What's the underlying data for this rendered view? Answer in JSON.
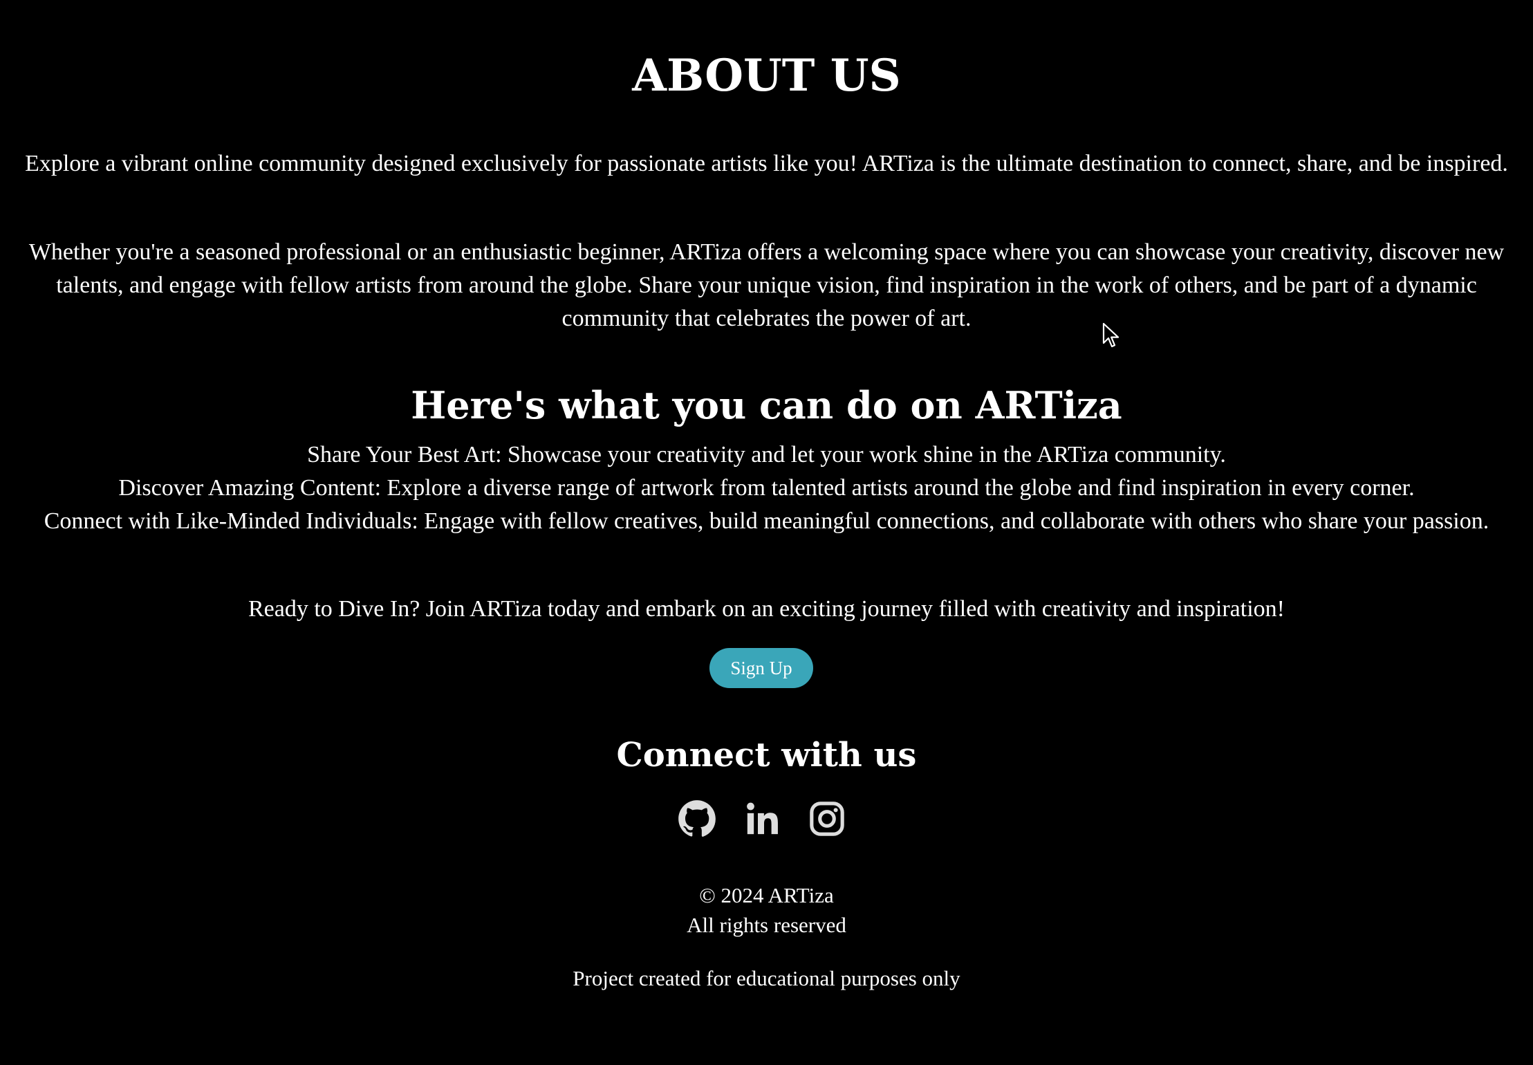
{
  "about": {
    "title": "ABOUT US",
    "intro": "Explore a vibrant online community designed exclusively for passionate artists like you! ARTiza is the ultimate destination to connect, share, and be inspired.",
    "description": "Whether you're a seasoned professional or an enthusiastic beginner, ARTiza offers a welcoming space where you can showcase your creativity, discover new talents, and engage with fellow artists from around the globe. Share your unique vision, find inspiration in the work of others, and be part of a dynamic community that celebrates the power of art."
  },
  "features": {
    "title": "Here's what you can do on ARTiza",
    "items": [
      "Share Your Best Art: Showcase your creativity and let your work shine in the ARTiza community.",
      "Discover Amazing Content: Explore a diverse range of artwork from talented artists around the globe and find inspiration in every corner.",
      "Connect with Like-Minded Individuals: Engage with fellow creatives, build meaningful connections, and collaborate with others who share your passion."
    ]
  },
  "cta": {
    "text": "Ready to Dive In? Join ARTiza today and embark on an exciting journey filled with creativity and inspiration!",
    "signup_label": "Sign Up"
  },
  "connect": {
    "title": "Connect with us",
    "icons": [
      "github-icon",
      "linkedin-icon",
      "instagram-icon"
    ]
  },
  "footer": {
    "copyright": "© 2024 ARTiza",
    "rights": "All rights reserved",
    "note": "Project created for educational purposes only"
  },
  "colors": {
    "background": "#000000",
    "text": "#ffffff",
    "accent": "#3aa6b9",
    "icon": "#dddddd"
  }
}
